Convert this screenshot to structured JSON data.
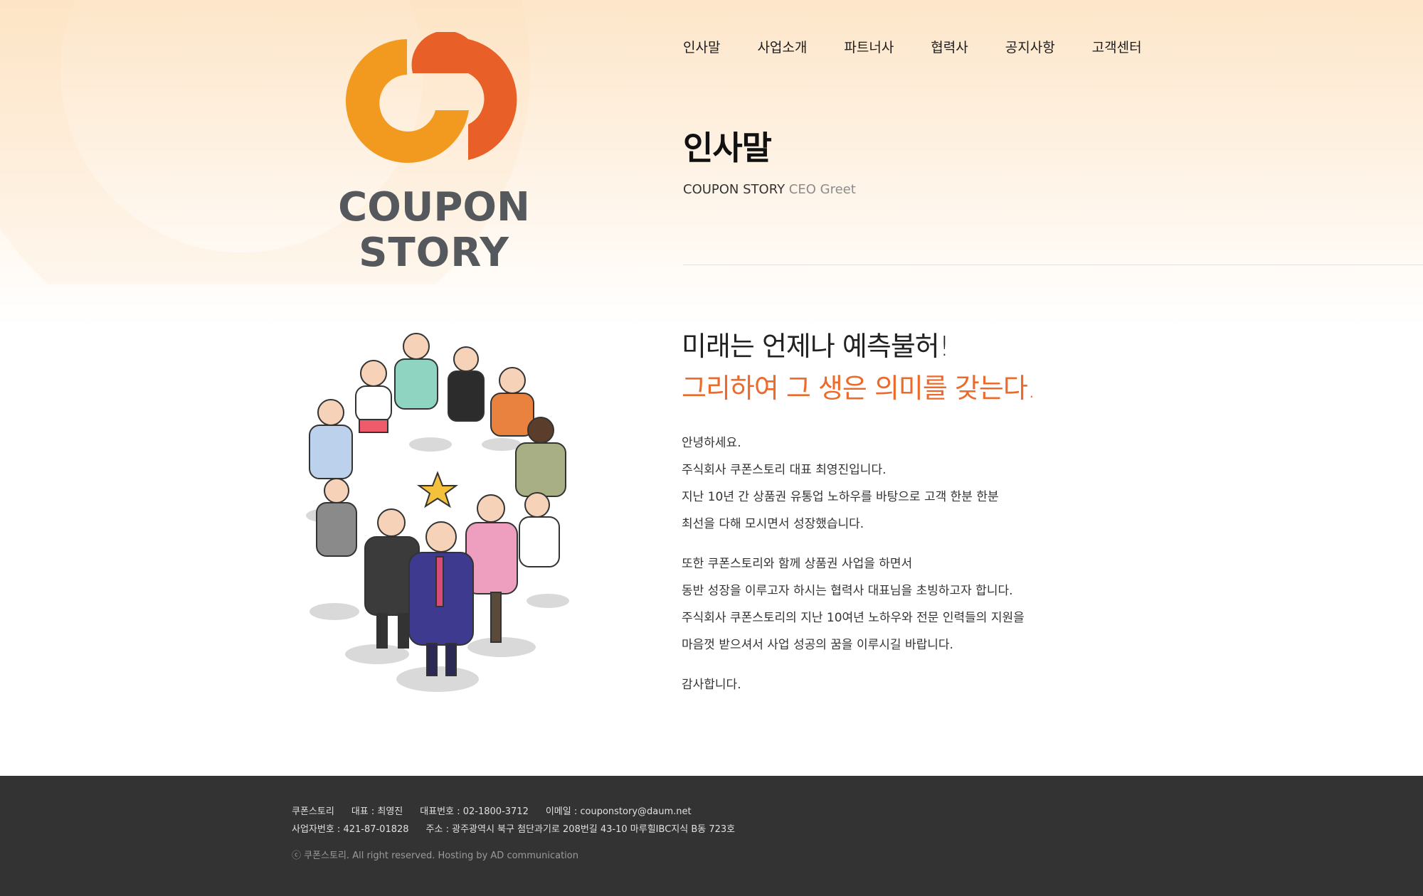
{
  "colors": {
    "accent": "#ec6a2b",
    "logo_orange": "#f29a1f",
    "logo_red": "#e85f27",
    "logo_gray": "#55585c",
    "footer_bg": "#333333"
  },
  "logo": {
    "line1": "COUPON",
    "line2": "STORY"
  },
  "nav": {
    "items": [
      {
        "label": "인사말"
      },
      {
        "label": "사업소개"
      },
      {
        "label": "파트너사"
      },
      {
        "label": "협력사"
      },
      {
        "label": "공지사항"
      },
      {
        "label": "고객센터"
      }
    ]
  },
  "page": {
    "title": "인사말",
    "subtitle_main": "COUPON STORY",
    "subtitle_accent": "CEO Greet"
  },
  "message": {
    "headline1": "미래는 언제나 예측불허!",
    "headline2": "그리하여 그 생은 의미를 갖는다.",
    "para1": [
      "안녕하세요.",
      "주식회사 쿠폰스토리 대표 최영진입니다.",
      "지난 10년 간 상품권 유통업 노하우를 바탕으로 고객 한분 한분",
      "최선을 다해 모시면서 성장했습니다."
    ],
    "para2": [
      "또한 쿠폰스토리와 함께 상품권 사업을 하면서",
      "동반 성장을 이루고자 하시는 협력사 대표님을 초빙하고자 합니다.",
      "주식회사 쿠폰스토리의 지난 10여년 노하우와 전문 인력들의 지원을",
      "마음껏 받으셔서 사업 성공의 꿈을 이루시길 바랍니다."
    ],
    "closing": "감사합니다."
  },
  "footer": {
    "company": "쿠폰스토리",
    "ceo": "대표 : 최영진",
    "phone": "대표번호 : 02-1800-3712",
    "email": "이메일 : couponstory@daum.net",
    "biz_no": "사업자번호 : 421-87-01828",
    "address": "주소 : 광주광역시 북구 첨단과기로 208번길 43-10 마루힐IBC지식 B동 723호",
    "copyright": "ⓒ 쿠폰스토리. All right reserved. Hosting by AD communication"
  }
}
